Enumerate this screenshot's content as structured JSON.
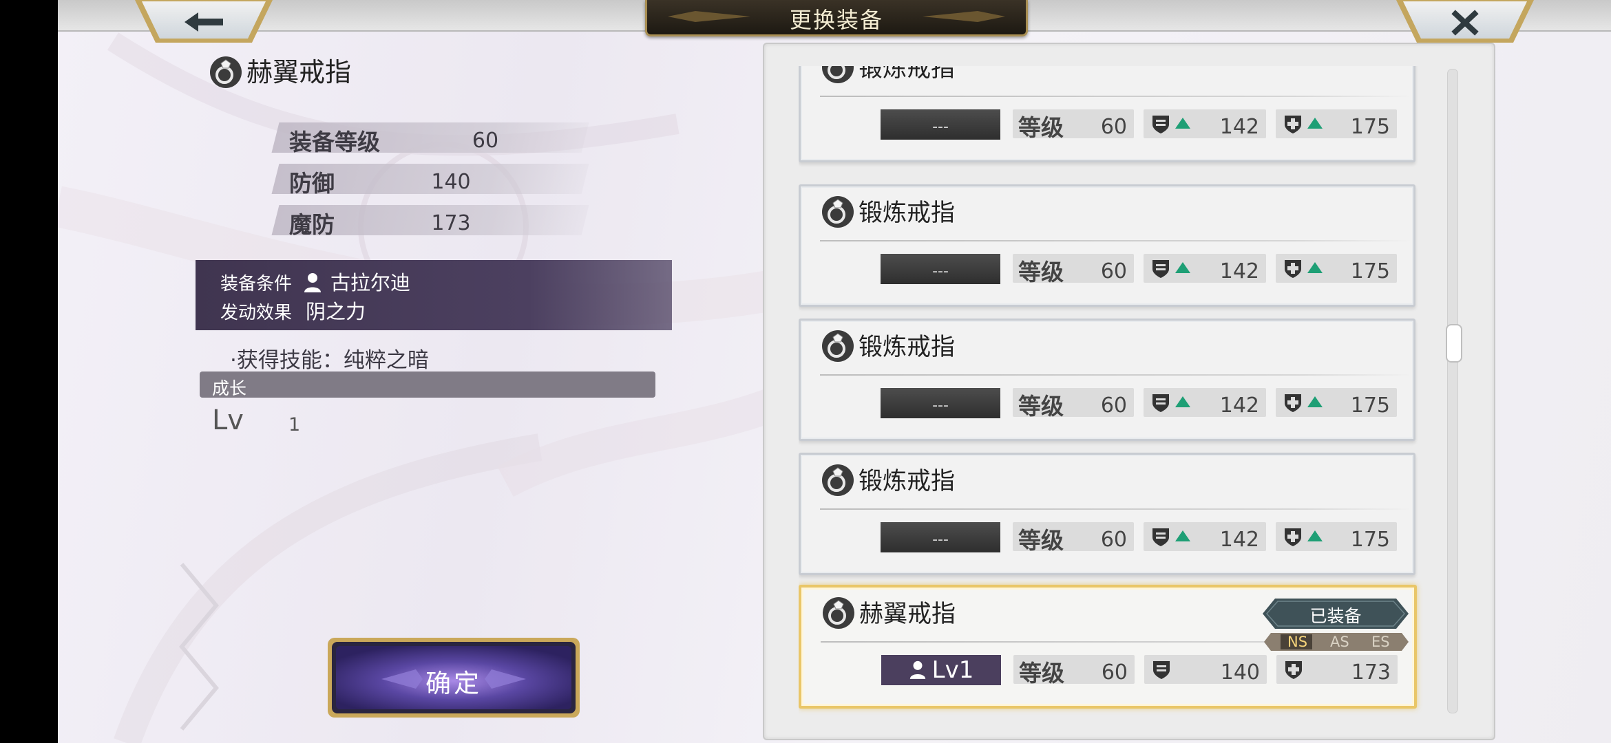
{
  "header": {
    "title": "更换装备"
  },
  "nav": {
    "back_icon": "arrow-left-icon",
    "close_icon": "close-x-icon"
  },
  "detail": {
    "name": "赫翼戒指",
    "stats": [
      {
        "label": "装备等级",
        "value": "60"
      },
      {
        "label": "防御",
        "value": "140"
      },
      {
        "label": "魔防",
        "value": "173"
      }
    ],
    "condition_label": "装备条件",
    "condition_value": "古拉尔迪",
    "effect_label": "发动效果",
    "effect_value": "阴之力",
    "skill": "·获得技能：纯粹之暗",
    "growth_label": "成长",
    "lv_label": "Lv",
    "lv_value": "1",
    "confirm_label": "确定"
  },
  "list": {
    "items": [
      {
        "name": "锻炼戒指",
        "owner": "---",
        "level_label": "等级",
        "level": "60",
        "def": "142",
        "mdef": "175"
      },
      {
        "name": "锻炼戒指",
        "owner": "---",
        "level_label": "等级",
        "level": "60",
        "def": "142",
        "mdef": "175"
      },
      {
        "name": "锻炼戒指",
        "owner": "---",
        "level_label": "等级",
        "level": "60",
        "def": "142",
        "mdef": "175"
      },
      {
        "name": "锻炼戒指",
        "owner": "---",
        "level_label": "等级",
        "level": "60",
        "def": "142",
        "mdef": "175"
      },
      {
        "name": "赫翼戒指",
        "owner": "Lv1",
        "level_label": "等级",
        "level": "60",
        "def": "140",
        "mdef": "173",
        "equipped_label": "已装备",
        "tags": [
          "NS",
          "AS",
          "ES"
        ]
      }
    ],
    "scroll_fraction": 0.4
  },
  "colors": {
    "accent_gold": "#e9c668",
    "panel_purple": "#433853",
    "up_arrow": "#1e9f75"
  }
}
